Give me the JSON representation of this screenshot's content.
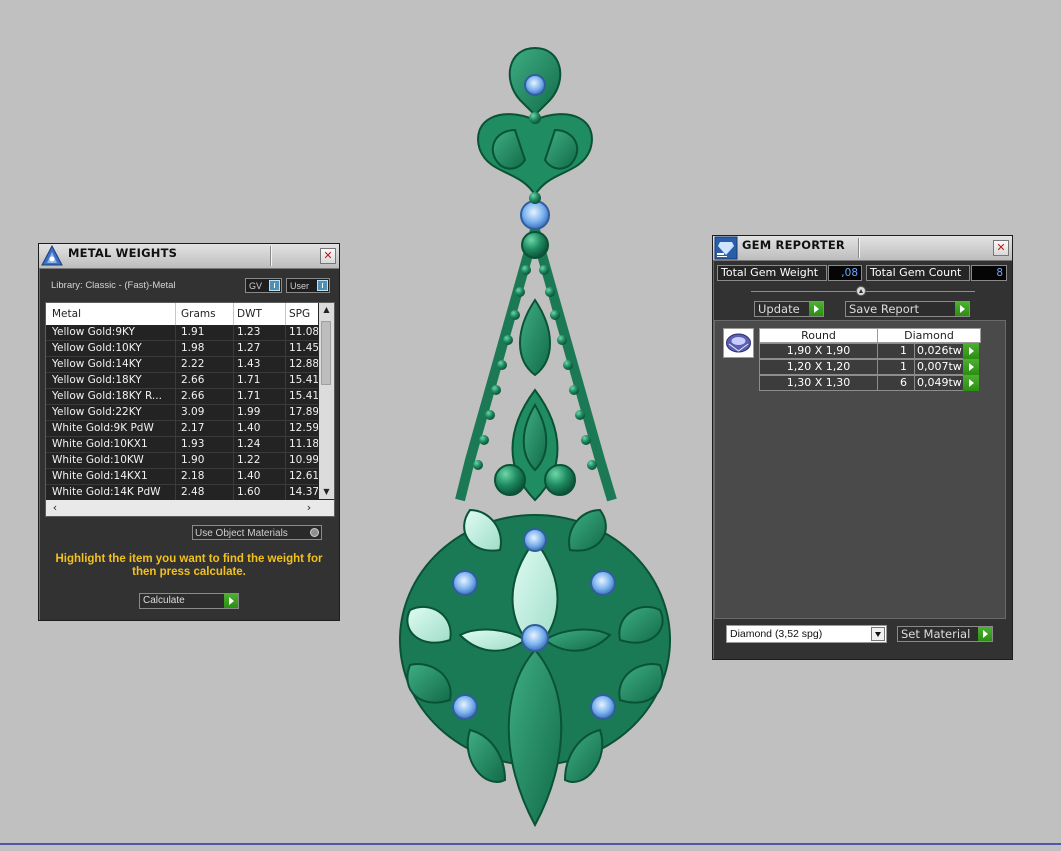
{
  "metal_weights": {
    "title": "METAL WEIGHTS",
    "library": "Library: Classic - (Fast)-Metal",
    "toggle_gv": "GV",
    "toggle_user": "User",
    "columns": [
      "Metal",
      "Grams",
      "DWT",
      "SPG"
    ],
    "rows": [
      [
        "Yellow Gold:9KY",
        "1.91",
        "1.23",
        "11.08"
      ],
      [
        "Yellow Gold:10KY",
        "1.98",
        "1.27",
        "11.45"
      ],
      [
        "Yellow Gold:14KY",
        "2.22",
        "1.43",
        "12.88"
      ],
      [
        "Yellow Gold:18KY",
        "2.66",
        "1.71",
        "15.41"
      ],
      [
        "Yellow Gold:18KY R...",
        "2.66",
        "1.71",
        "15.41"
      ],
      [
        "Yellow Gold:22KY",
        "3.09",
        "1.99",
        "17.89"
      ],
      [
        "White Gold:9K PdW",
        "2.17",
        "1.40",
        "12.59"
      ],
      [
        "White Gold:10KX1",
        "1.93",
        "1.24",
        "11.18"
      ],
      [
        "White Gold:10KW",
        "1.90",
        "1.22",
        "10.99"
      ],
      [
        "White Gold:14KX1",
        "2.18",
        "1.40",
        "12.61"
      ],
      [
        "White Gold:14K PdW",
        "2.48",
        "1.60",
        "14.37"
      ]
    ],
    "use_object_materials": "Use Object Materials",
    "hint": "Highlight the item you want to find the weight for then press calculate.",
    "calculate_label": "Calculate",
    "close_label": "✕"
  },
  "gem_reporter": {
    "title": "GEM REPORTER",
    "total_weight_label": "Total Gem Weight",
    "total_weight_value": ",08",
    "total_count_label": "Total Gem Count",
    "total_count_value": "8",
    "update_label": "Update",
    "save_report_label": "Save Report",
    "table_headers": [
      "Round",
      "Diamond"
    ],
    "rows": [
      {
        "size": "1,90 X 1,90",
        "qty": "1",
        "weight": "0,026tw"
      },
      {
        "size": "1,20 X 1,20",
        "qty": "1",
        "weight": "0,007tw"
      },
      {
        "size": "1,30 X 1,30",
        "qty": "6",
        "weight": "0,049tw"
      }
    ],
    "material_select": "Diamond    (3,52 spg)",
    "set_material_label": "Set Material",
    "close_label": "✕"
  },
  "colors": {
    "background": "#c0c0c0",
    "metal_green": "#1f8c62",
    "gem_blue": "#7ab2ee",
    "hint_yellow": "#f2c21b",
    "accent_go": "#3aa020"
  }
}
